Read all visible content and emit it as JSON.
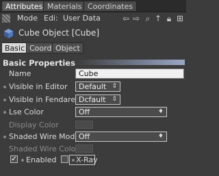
{
  "top_tabs": [
    "Attributes",
    "Materials",
    "Coordinates"
  ],
  "toolbar": {
    "menu_mode": "Mode",
    "menu_edit": "Edi:",
    "menu_userdata": "User Data"
  },
  "object": {
    "title": "Cube Object [Cube]"
  },
  "sub_tabs": [
    "Basic",
    "Coord.",
    "Object"
  ],
  "section": {
    "title": "Basic Properties"
  },
  "props": {
    "name_label": "Name",
    "name_value": "Cube",
    "visible_editor_label": "Visible in Editor",
    "visible_editor_value": "Default",
    "visible_renderer_label": "Visible in Fendarer",
    "visible_renderer_value": "Dcfault",
    "use_color_label": "Lse Color",
    "use_color_value": "Off",
    "display_color_label": "Display Color",
    "shaded_wire_mode_label": "Shaded Wire Mode",
    "shaded_wire_mode_value": "Off",
    "shaded_wire_color_label": "Shaded Wire Color",
    "enabled_label": "Enabled",
    "xray_label": "X-Ray"
  },
  "colors": {
    "field_border": "#c8c8c8",
    "header_gradient": "#9aa7c6"
  }
}
